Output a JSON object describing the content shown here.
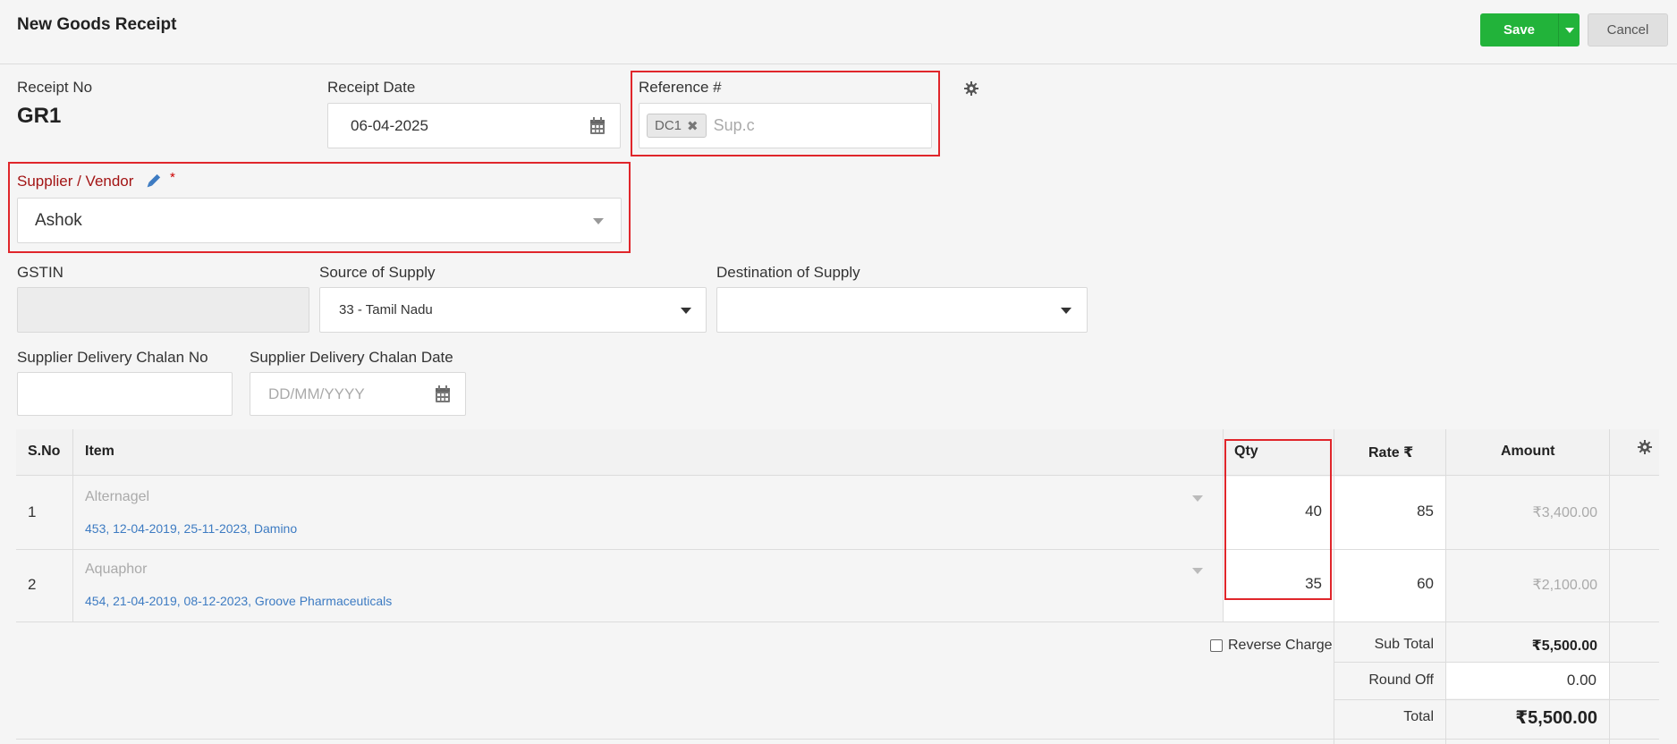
{
  "header": {
    "title": "New Goods Receipt",
    "save_label": "Save",
    "cancel_label": "Cancel"
  },
  "form": {
    "receipt_no_label": "Receipt No",
    "receipt_no_value": "GR1",
    "receipt_date_label": "Receipt Date",
    "receipt_date_value": "06-04-2025",
    "reference_label": "Reference #",
    "reference_chip": "DC1",
    "reference_input_text": "Sup.c",
    "supplier_label": "Supplier / Vendor",
    "supplier_required": "*",
    "supplier_value": "Ashok",
    "gstin_label": "GSTIN",
    "gstin_value": "",
    "source_label": "Source of Supply",
    "source_value": "33 - Tamil Nadu",
    "destination_label": "Destination of Supply",
    "destination_value": "",
    "chalan_no_label": "Supplier Delivery Chalan No",
    "chalan_no_value": "",
    "chalan_date_label": "Supplier Delivery Chalan Date",
    "chalan_date_placeholder": "DD/MM/YYYY"
  },
  "table": {
    "columns": {
      "sno": "S.No",
      "item": "Item",
      "qty": "Qty",
      "rate": "Rate ₹",
      "amount": "Amount"
    },
    "rows": [
      {
        "sno": "1",
        "item": "Alternagel",
        "meta": "453, 12-04-2019, 25-11-2023, Damino",
        "qty": "40",
        "rate": "85",
        "amount": "₹3,400.00"
      },
      {
        "sno": "2",
        "item": "Aquaphor",
        "meta": "454, 21-04-2019, 08-12-2023, Groove Pharmaceuticals",
        "qty": "35",
        "rate": "60",
        "amount": "₹2,100.00"
      }
    ]
  },
  "totals": {
    "reverse_charge_label": "Reverse Charge",
    "reverse_charge_checked": false,
    "subtotal_label": "Sub Total",
    "subtotal_value": "₹5,500.00",
    "round_off_label": "Round Off",
    "round_off_value": "0.00",
    "total_label": "Total",
    "total_value": "₹5,500.00"
  },
  "colors": {
    "save_green": "#22b33a",
    "highlight_red": "#e0262b",
    "required_red": "#b22222",
    "link_blue": "#3d7bc2",
    "edit_icon_blue": "#3d7bc2"
  },
  "icons": {
    "calendar": "calendar-icon",
    "gear": "gear-icon",
    "pencil": "pencil-icon",
    "close": "close-icon",
    "dropdown": "chevron-down-icon"
  }
}
